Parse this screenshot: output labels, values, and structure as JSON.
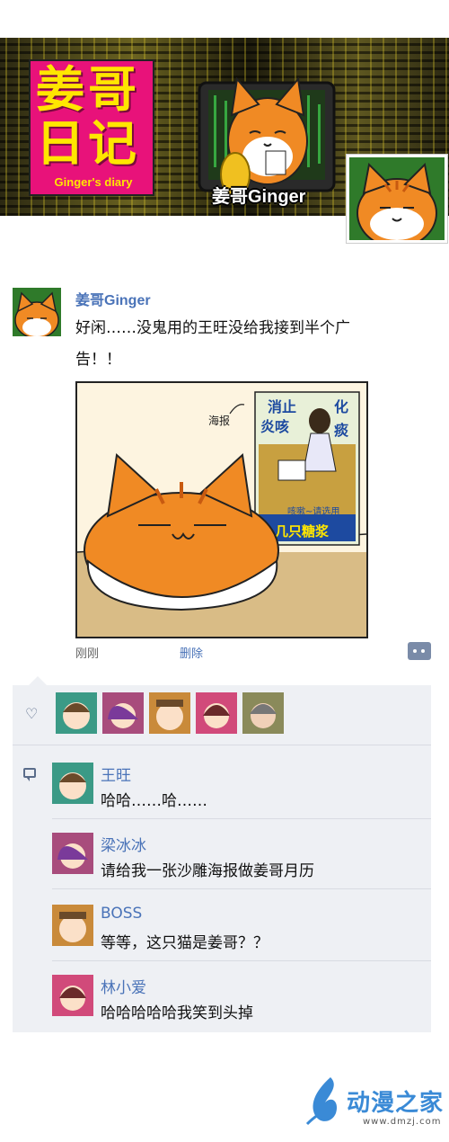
{
  "banner": {
    "title_cn_line1": "姜哥",
    "title_cn_line2": "日记",
    "title_en": "Ginger's diary",
    "name": "姜哥Ginger"
  },
  "post": {
    "author": "姜哥Ginger",
    "text": "好闲……没鬼用的王旺没给我接到半个广告！！",
    "image": {
      "poster_tag": "海报",
      "poster_title_left": "消止",
      "poster_title_right": "化",
      "poster_sub_left": "炎咳",
      "poster_sub_right": "痰",
      "poster_caption": "咳嗽~请选用",
      "poster_brand": "几只糖浆"
    },
    "time": "刚刚",
    "delete_label": "删除"
  },
  "likes": {
    "count_avatars": 5,
    "colors": [
      "#3b9a86",
      "#a84c7c",
      "#c98a3a",
      "#d14a7a",
      "#8a8a5a"
    ]
  },
  "comments": [
    {
      "name": "王旺",
      "text": "哈哈……哈……"
    },
    {
      "name": "梁冰冰",
      "text": "请给我一张沙雕海报做姜哥月历"
    },
    {
      "name": "BOSS",
      "text": "等等，这只猫是姜哥？？"
    },
    {
      "name": "林小爱",
      "text": "哈哈哈哈哈我笑到头掉"
    }
  ],
  "watermark": {
    "name": "动漫之家",
    "url": "www.dmzj.com"
  },
  "colors": {
    "link_blue": "#4a73b8",
    "magenta": "#e8127a",
    "yellow": "#ffe600",
    "cat_orange": "#f08a24",
    "comment_bg": "#eef0f4"
  }
}
